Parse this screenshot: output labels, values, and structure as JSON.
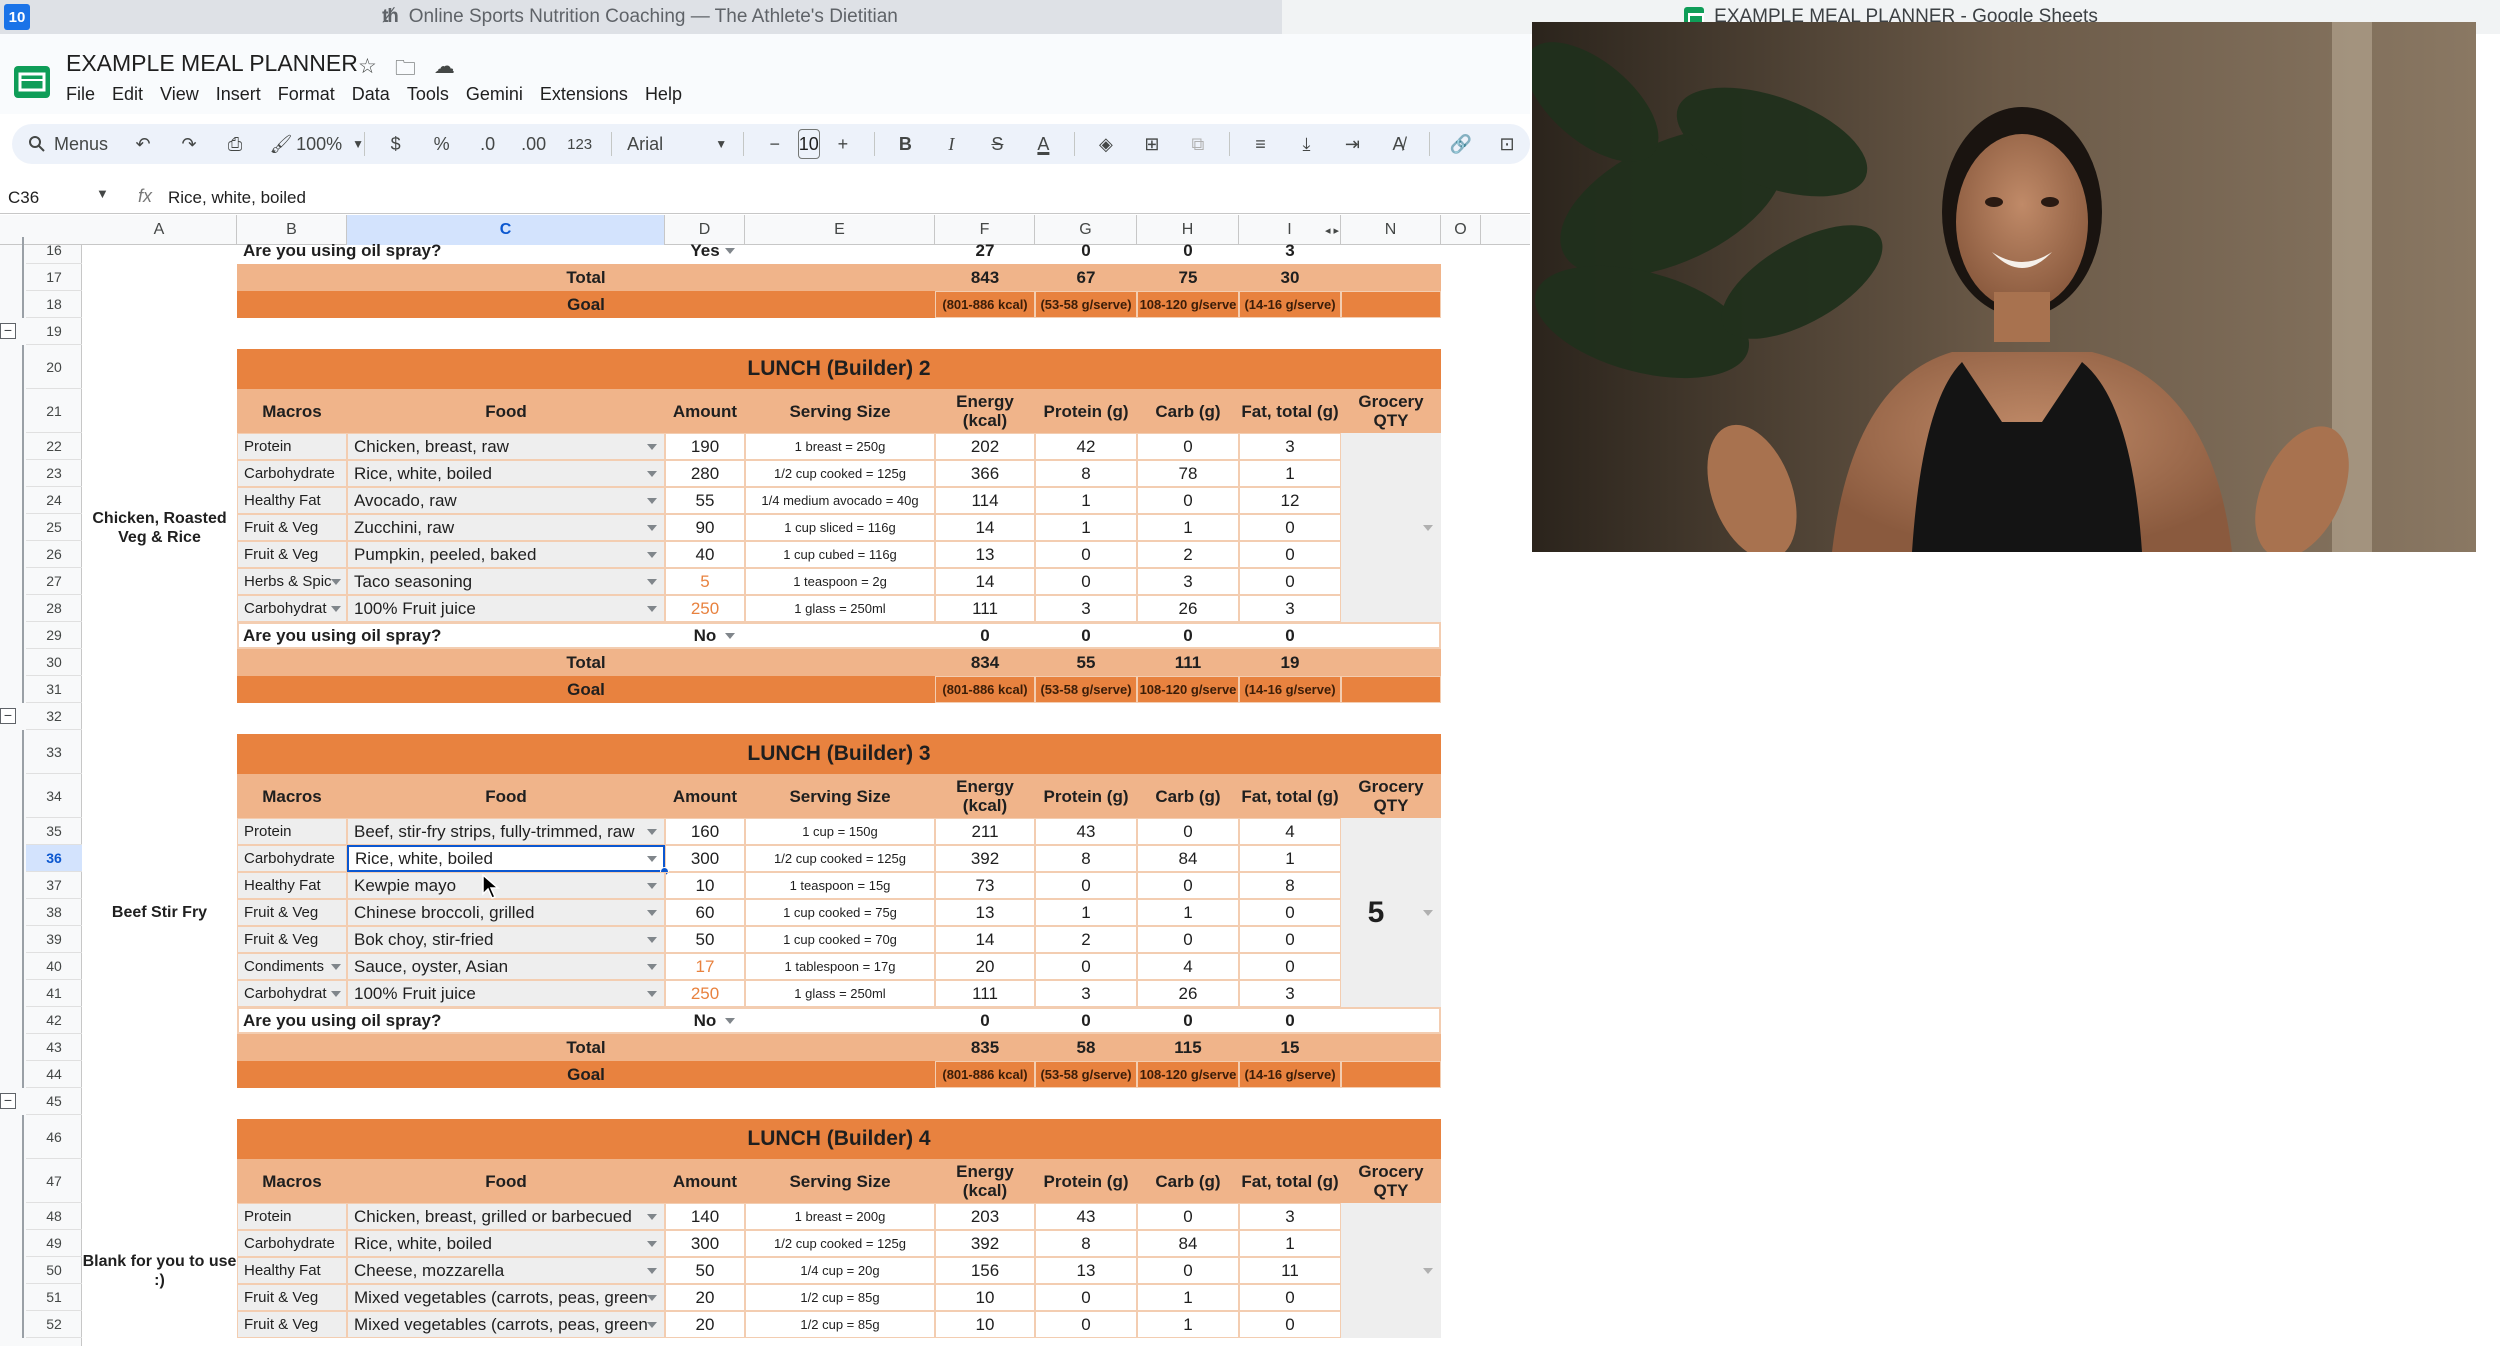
{
  "browser": {
    "badge": "10",
    "tab_left_title": "Online Sports Nutrition Coaching — The Athlete's Dietitian",
    "tab_right_title": "EXAMPLE MEAL PLANNER - Google Sheets"
  },
  "document": {
    "title": "EXAMPLE MEAL PLANNER",
    "menu": [
      "File",
      "Edit",
      "View",
      "Insert",
      "Format",
      "Data",
      "Tools",
      "Gemini",
      "Extensions",
      "Help"
    ]
  },
  "toolbar": {
    "search_label": "Menus",
    "zoom": "100%",
    "currency": "$",
    "percent": "%",
    "dec_decrease": ".0",
    "dec_increase": ".00",
    "number_format": "123",
    "font": "Arial",
    "font_size": "10",
    "bold": "B",
    "italic": "I",
    "strike": "S",
    "text_color": "A"
  },
  "formula_bar": {
    "cell_ref": "C36",
    "content": "Rice, white, boiled"
  },
  "columns": [
    "A",
    "B",
    "C",
    "D",
    "E",
    "F",
    "G",
    "H",
    "I",
    "N",
    "O"
  ],
  "headers": {
    "macros": "Macros",
    "food": "Food",
    "amount": "Amount",
    "serving": "Serving Size",
    "energy": "Energy (kcal)",
    "protein": "Protein (g)",
    "carb": "Carb (g)",
    "fat": "Fat, total (g)",
    "grocery": "Grocery QTY"
  },
  "labels": {
    "spray_question": "Are you using oil spray?",
    "total": "Total",
    "goal": "Goal"
  },
  "goals": [
    "(801-886 kcal)",
    "(53-58 g/serve)",
    "108-120 g/serve",
    "(14-16 g/serve)"
  ],
  "top_partial": {
    "spray_answer": "Yes",
    "spray": [
      "27",
      "0",
      "0",
      "3"
    ],
    "total": [
      "843",
      "67",
      "75",
      "30"
    ]
  },
  "sections": [
    {
      "title": "LUNCH (Builder) 2",
      "meal": "Chicken, Roasted Veg & Rice",
      "grocery": "",
      "rows": [
        {
          "macro": "Protein",
          "food": "Chicken, breast, raw",
          "amount": "190",
          "serving": "1 breast = 250g",
          "energy": "202",
          "protein": "42",
          "carb": "0",
          "fat": "3"
        },
        {
          "macro": "Carbohydrate",
          "food": "Rice, white, boiled",
          "amount": "280",
          "serving": "1/2 cup cooked = 125g",
          "energy": "366",
          "protein": "8",
          "carb": "78",
          "fat": "1"
        },
        {
          "macro": "Healthy Fat",
          "food": "Avocado, raw",
          "amount": "55",
          "serving": "1/4 medium avocado = 40g",
          "energy": "114",
          "protein": "1",
          "carb": "0",
          "fat": "12"
        },
        {
          "macro": "Fruit & Veg",
          "food": "Zucchini, raw",
          "amount": "90",
          "serving": "1 cup sliced = 116g",
          "energy": "14",
          "protein": "1",
          "carb": "1",
          "fat": "0"
        },
        {
          "macro": "Fruit & Veg",
          "food": "Pumpkin, peeled, baked",
          "amount": "40",
          "serving": "1 cup cubed = 116g",
          "energy": "13",
          "protein": "0",
          "carb": "2",
          "fat": "0"
        },
        {
          "macro": "Herbs & Spic",
          "food": "Taco seasoning",
          "amount": "5",
          "serving": "1 teaspoon = 2g",
          "energy": "14",
          "protein": "0",
          "carb": "3",
          "fat": "0"
        },
        {
          "macro": "Carbohydrat",
          "food": "100% Fruit juice",
          "amount": "250",
          "serving": "1 glass = 250ml",
          "energy": "111",
          "protein": "3",
          "carb": "26",
          "fat": "3"
        }
      ],
      "spray_answer": "No",
      "spray": [
        "0",
        "0",
        "0",
        "0"
      ],
      "total": [
        "834",
        "55",
        "111",
        "19"
      ]
    },
    {
      "title": "LUNCH (Builder) 3",
      "meal": "Beef Stir Fry",
      "grocery": "5",
      "rows": [
        {
          "macro": "Protein",
          "food": "Beef, stir-fry strips, fully-trimmed, raw",
          "amount": "160",
          "serving": "1 cup = 150g",
          "energy": "211",
          "protein": "43",
          "carb": "0",
          "fat": "4"
        },
        {
          "macro": "Carbohydrate",
          "food": "Rice, white, boiled",
          "amount": "300",
          "serving": "1/2 cup cooked = 125g",
          "energy": "392",
          "protein": "8",
          "carb": "84",
          "fat": "1"
        },
        {
          "macro": "Healthy Fat",
          "food": "Kewpie mayo",
          "amount": "10",
          "serving": "1 teaspoon = 15g",
          "energy": "73",
          "protein": "0",
          "carb": "0",
          "fat": "8"
        },
        {
          "macro": "Fruit & Veg",
          "food": "Chinese broccoli, grilled",
          "amount": "60",
          "serving": "1 cup cooked = 75g",
          "energy": "13",
          "protein": "1",
          "carb": "1",
          "fat": "0"
        },
        {
          "macro": "Fruit & Veg",
          "food": "Bok choy, stir-fried",
          "amount": "50",
          "serving": "1 cup cooked = 70g",
          "energy": "14",
          "protein": "2",
          "carb": "0",
          "fat": "0"
        },
        {
          "macro": "Condiments",
          "food": "Sauce, oyster, Asian",
          "amount": "17",
          "serving": "1 tablespoon = 17g",
          "energy": "20",
          "protein": "0",
          "carb": "4",
          "fat": "0"
        },
        {
          "macro": "Carbohydrat",
          "food": "100% Fruit juice",
          "amount": "250",
          "serving": "1 glass = 250ml",
          "energy": "111",
          "protein": "3",
          "carb": "26",
          "fat": "3"
        }
      ],
      "spray_answer": "No",
      "spray": [
        "0",
        "0",
        "0",
        "0"
      ],
      "total": [
        "835",
        "58",
        "115",
        "15"
      ]
    },
    {
      "title": "LUNCH (Builder) 4",
      "meal": "Blank for you to use :)",
      "grocery": "",
      "rows": [
        {
          "macro": "Protein",
          "food": "Chicken, breast, grilled or barbecued",
          "amount": "140",
          "serving": "1 breast = 200g",
          "energy": "203",
          "protein": "43",
          "carb": "0",
          "fat": "3"
        },
        {
          "macro": "Carbohydrate",
          "food": "Rice, white, boiled",
          "amount": "300",
          "serving": "1/2 cup cooked = 125g",
          "energy": "392",
          "protein": "8",
          "carb": "84",
          "fat": "1"
        },
        {
          "macro": "Healthy Fat",
          "food": "Cheese, mozzarella",
          "amount": "50",
          "serving": "1/4 cup = 20g",
          "energy": "156",
          "protein": "13",
          "carb": "0",
          "fat": "11"
        },
        {
          "macro": "Fruit & Veg",
          "food": "Mixed vegetables (carrots, peas, green",
          "amount": "20",
          "serving": "1/2 cup = 85g",
          "energy": "10",
          "protein": "0",
          "carb": "1",
          "fat": "0"
        },
        {
          "macro": "Fruit & Veg",
          "food": "Mixed vegetables (carrots, peas, green",
          "amount": "20",
          "serving": "1/2 cup = 85g",
          "energy": "10",
          "protein": "0",
          "carb": "1",
          "fat": "0"
        }
      ]
    }
  ],
  "row_numbers": [
    "16",
    "17",
    "18",
    "19",
    "20",
    "21",
    "22",
    "23",
    "24",
    "25",
    "26",
    "27",
    "28",
    "29",
    "30",
    "31",
    "32",
    "33",
    "34",
    "35",
    "36",
    "37",
    "38",
    "39",
    "40",
    "41",
    "42",
    "43",
    "44",
    "45",
    "46",
    "47",
    "48",
    "49",
    "50",
    "51",
    "52"
  ],
  "selected_row": "36",
  "selected_col": "C",
  "orange_amounts": [
    "5",
    "17",
    "250"
  ],
  "colors": {
    "section_title": "#e8823f",
    "header_peach": "#f0b48a",
    "accent_blue": "#0b57d0",
    "orange_text": "#e8823f"
  }
}
